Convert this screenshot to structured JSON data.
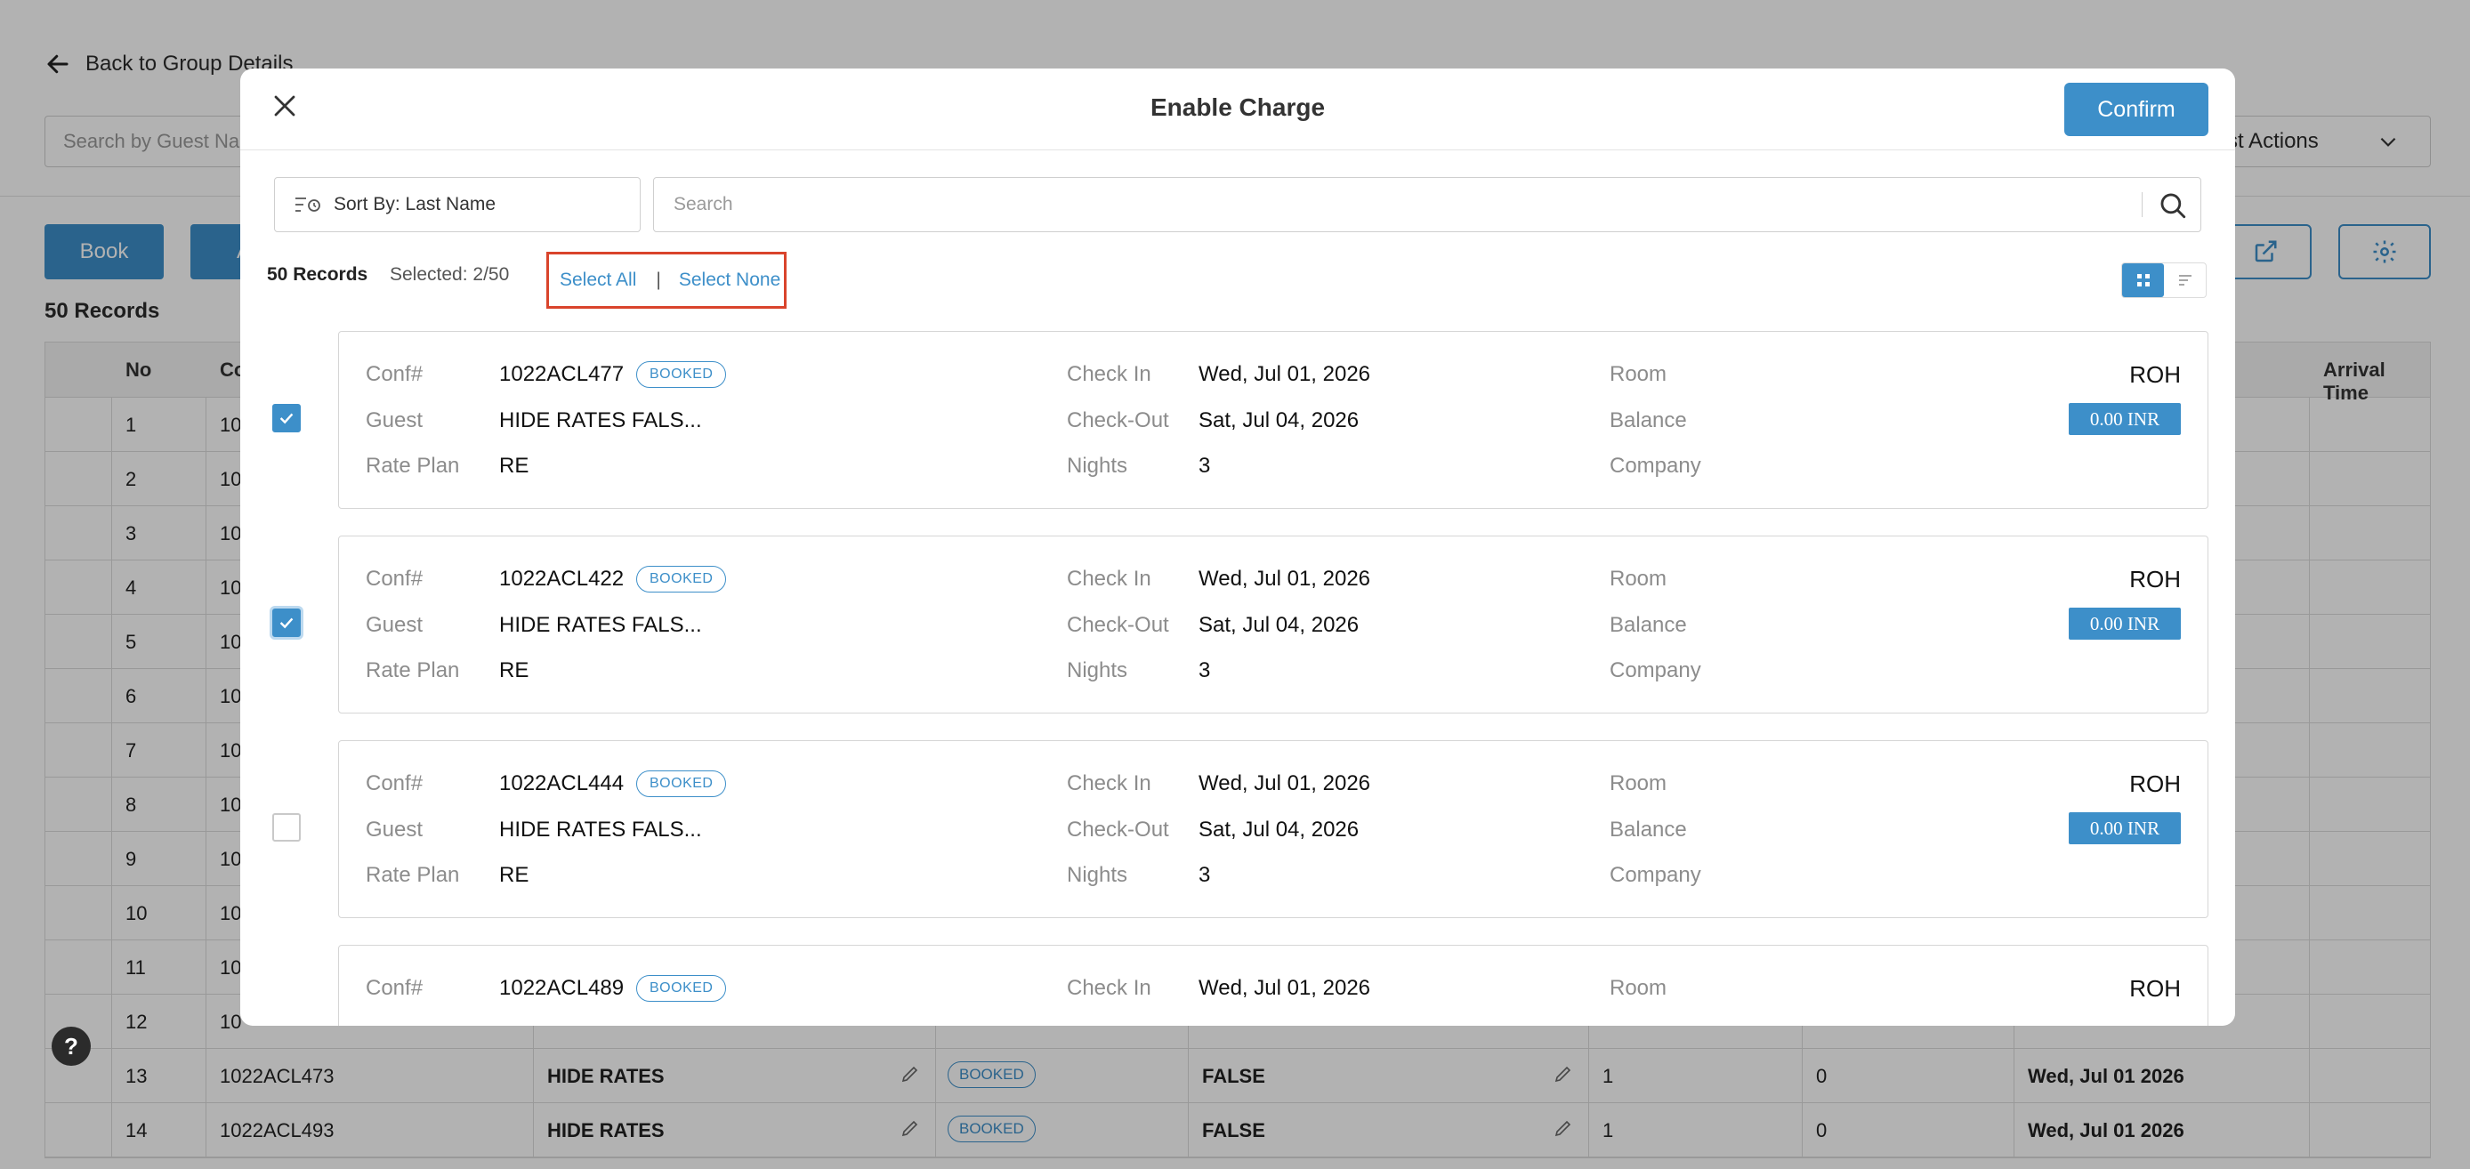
{
  "background": {
    "back_label": "Back to Group Details",
    "search_placeholder": "Search by Guest Nam",
    "actions_label": "ng List Actions",
    "book_label": "Book",
    "second_btn_label": "A",
    "records_label": "50 Records",
    "table": {
      "headers": [
        "No",
        "Co",
        "Arrival Time"
      ],
      "rows_partial": [
        {
          "no": "1",
          "conf": "10"
        },
        {
          "no": "2",
          "conf": "10"
        },
        {
          "no": "3",
          "conf": "10"
        },
        {
          "no": "4",
          "conf": "10"
        },
        {
          "no": "5",
          "conf": "10"
        },
        {
          "no": "6",
          "conf": "10"
        },
        {
          "no": "7",
          "conf": "10"
        },
        {
          "no": "8",
          "conf": "10"
        },
        {
          "no": "9",
          "conf": "10"
        },
        {
          "no": "10",
          "conf": "10"
        },
        {
          "no": "11",
          "conf": "10"
        },
        {
          "no": "12",
          "conf": "10"
        }
      ],
      "rows_full": [
        {
          "no": "13",
          "conf": "1022ACL473",
          "rate": "HIDE RATES",
          "status": "BOOKED",
          "flag": "FALSE",
          "nights": "1",
          "count": "0",
          "date": "Wed, Jul 01 2026"
        },
        {
          "no": "14",
          "conf": "1022ACL493",
          "rate": "HIDE RATES",
          "status": "BOOKED",
          "flag": "FALSE",
          "nights": "1",
          "count": "0",
          "date": "Wed, Jul 01 2026"
        }
      ]
    },
    "help_label": "?"
  },
  "modal": {
    "title": "Enable Charge",
    "confirm_label": "Confirm",
    "sort_label": "Sort By: Last Name",
    "search_placeholder": "Search",
    "records_label": "50 Records",
    "selected_label": "Selected: 2/50",
    "select_all_label": "Select All",
    "separator": "|",
    "select_none_label": "Select None",
    "labels": {
      "conf": "Conf#",
      "guest": "Guest",
      "rate_plan": "Rate Plan",
      "check_in": "Check In",
      "check_out": "Check-Out",
      "nights": "Nights",
      "room": "Room",
      "balance": "Balance",
      "company": "Company"
    },
    "cards": [
      {
        "conf": "1022ACL477",
        "status": "BOOKED",
        "guest": "HIDE RATES FALS...",
        "rate_plan": "RE",
        "check_in": "Wed, Jul 01, 2026",
        "check_out": "Sat, Jul 04, 2026",
        "nights": "3",
        "room": "ROH",
        "balance": "0.00 INR",
        "checked": true
      },
      {
        "conf": "1022ACL422",
        "status": "BOOKED",
        "guest": "HIDE RATES FALS...",
        "rate_plan": "RE",
        "check_in": "Wed, Jul 01, 2026",
        "check_out": "Sat, Jul 04, 2026",
        "nights": "3",
        "room": "ROH",
        "balance": "0.00 INR",
        "checked": true
      },
      {
        "conf": "1022ACL444",
        "status": "BOOKED",
        "guest": "HIDE RATES FALS...",
        "rate_plan": "RE",
        "check_in": "Wed, Jul 01, 2026",
        "check_out": "Sat, Jul 04, 2026",
        "nights": "3",
        "room": "ROH",
        "balance": "0.00 INR",
        "checked": false
      },
      {
        "conf": "1022ACL489",
        "status": "BOOKED",
        "check_in": "Wed, Jul 01, 2026",
        "room": "ROH"
      }
    ]
  },
  "colors": {
    "accent": "#3d8fc9",
    "highlight_border": "#d9442c"
  }
}
